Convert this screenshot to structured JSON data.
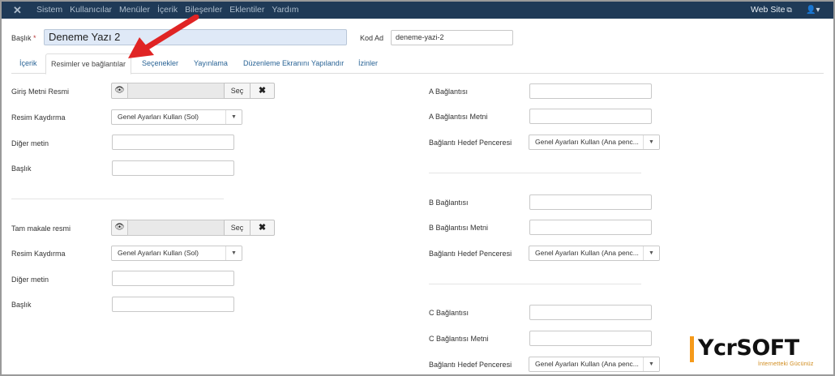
{
  "navbar": {
    "logo_icon": "joomla-icon",
    "menu": [
      "Sistem",
      "Kullanıcılar",
      "Menüler",
      "İçerik",
      "Bileşenler",
      "Eklentiler",
      "Yardım"
    ],
    "site_link": "Web Site",
    "site_icon": "external-link-icon",
    "user_icon": "user-icon"
  },
  "form": {
    "title_label": "Başlık",
    "required_mark": "*",
    "title_value": "Deneme Yazı 2",
    "alias_label": "Kod Ad",
    "alias_value": "deneme-yazi-2"
  },
  "tabs": [
    {
      "label": "İçerik",
      "active": false
    },
    {
      "label": "Resimler ve bağlantılar",
      "active": true
    },
    {
      "label": "Seçenekler",
      "active": false
    },
    {
      "label": "Yayınlama",
      "active": false
    },
    {
      "label": "Düzenleme Ekranını Yapılandır",
      "active": false
    },
    {
      "label": "İzinler",
      "active": false
    }
  ],
  "images": {
    "intro": {
      "image_label": "Giriş Metni Resmi",
      "select_button": "Seç",
      "float_label": "Resim Kaydırma",
      "float_value": "Genel Ayarları Kullan (Sol)",
      "alt_label": "Diğer metin",
      "caption_label": "Başlık"
    },
    "full": {
      "image_label": "Tam makale resmi",
      "select_button": "Seç",
      "float_label": "Resim Kaydırma",
      "float_value": "Genel Ayarları Kullan (Sol)",
      "alt_label": "Diğer metin",
      "caption_label": "Başlık"
    }
  },
  "links": {
    "a": {
      "link_label": "A Bağlantısı",
      "text_label": "A Bağlantısı Metni",
      "target_label": "Bağlantı Hedef Penceresi",
      "target_value": "Genel Ayarları Kullan (Ana penc..."
    },
    "b": {
      "link_label": "B Bağlantısı",
      "text_label": "B Bağlantısı Metni",
      "target_label": "Bağlantı Hedef Penceresi",
      "target_value": "Genel Ayarları Kullan (Ana penc..."
    },
    "c": {
      "link_label": "C Bağlantısı",
      "text_label": "C Bağlantısı Metni",
      "target_label": "Bağlantı Hedef Penceresi",
      "target_value": "Genel Ayarları Kullan (Ana penc..."
    }
  },
  "colors": {
    "navbar": "#1f3a57",
    "arrow": "#e02424",
    "watermark_accent": "#f59a1a"
  },
  "watermark": {
    "brand": "YcrSOFT",
    "slogan": "İnternetteki Gücünüz"
  }
}
